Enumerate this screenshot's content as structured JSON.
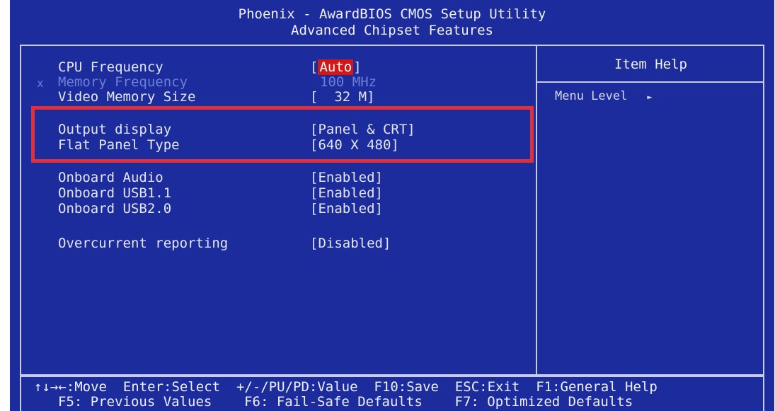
{
  "header": {
    "title": "Phoenix - AwardBIOS CMOS Setup Utility",
    "subtitle": "Advanced Chipset Features"
  },
  "settings": [
    {
      "label": "CPU Frequency",
      "value_pre": "[",
      "value_sel": "Auto",
      "value_post": "]"
    },
    {
      "marker": "x",
      "label": "Memory Frequency",
      "value": "100 MHz"
    },
    {
      "label": "Video Memory Size",
      "value": "[  32 M]"
    },
    {
      "label": "Output display",
      "value": "[Panel & CRT]"
    },
    {
      "label": "Flat Panel Type",
      "value": "[640 X 480]"
    },
    {
      "label": "Onboard Audio",
      "value": "[Enabled]"
    },
    {
      "label": "Onboard USB1.1",
      "value": "[Enabled]"
    },
    {
      "label": "Onboard USB2.0",
      "value": "[Enabled]"
    },
    {
      "label": "Overcurrent reporting",
      "value": "[Disabled]"
    }
  ],
  "help": {
    "title": "Item Help",
    "menu_level": "Menu Level",
    "arrow_icon": "right-triangle-icon",
    "arrow": "►"
  },
  "footer": {
    "line1": "↑↓→←:Move  Enter:Select  +/-/PU/PD:Value  F10:Save  ESC:Exit  F1:General Help",
    "line2": "F5: Previous Values    F6: Fail-Safe Defaults    F7: Optimized Defaults"
  },
  "colors": {
    "background": "#1c2c9c",
    "text": "#e4e6ef",
    "disabled_text": "#6e7fd8",
    "selection": "#d01818",
    "annotation_box": "#e0303a"
  }
}
